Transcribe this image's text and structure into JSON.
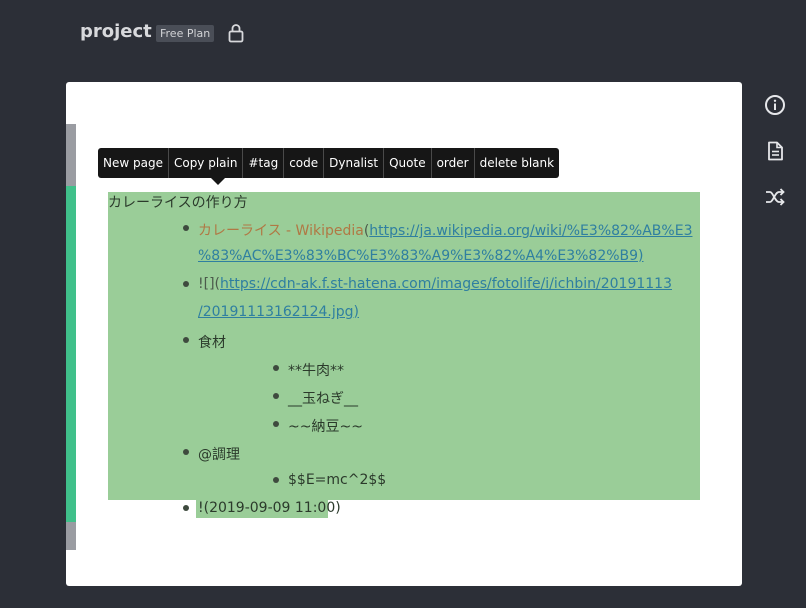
{
  "header": {
    "project_name": "project",
    "plan_badge": "Free Plan",
    "lock_icon": "lock-icon"
  },
  "toolbar": {
    "buttons": [
      "New page",
      "Copy plain",
      "#tag",
      "code",
      "Dynalist",
      "Quote",
      "order",
      "delete blank"
    ]
  },
  "document": {
    "root": "カレーライスの作り方",
    "wiki_text": "カレーライス - Wikipedia",
    "wiki_open": "(",
    "wiki_url_1": "https://ja.wikipedia.org/wiki/%E3%82%AB%E3",
    "wiki_url_2": "%83%AC%E3%83%BC%E3%83%A9%E3%82%A4%E3%82%B9)",
    "img_prefix": "![](",
    "img_url_1": "https://cdn-ak.f.st-hatena.com/images/fotolife/i/ichbin/20191113",
    "img_url_2": "/20191113162124.jpg)",
    "ingredients": "食材",
    "ingredient_items": [
      "**牛肉**",
      "__玉ねぎ__",
      "~~納豆~~"
    ],
    "cooking": "@調理",
    "formula": "$$E=mc^2$$",
    "date": "!(2019-09-09 11:00)"
  },
  "sidebar": {
    "icons": [
      "info-icon",
      "document-icon",
      "shuffle-icon"
    ]
  },
  "colors": {
    "background": "#2c2f37",
    "selection": "#9acd98",
    "accent_green": "#40c08a",
    "link": "#2f7fa0"
  }
}
